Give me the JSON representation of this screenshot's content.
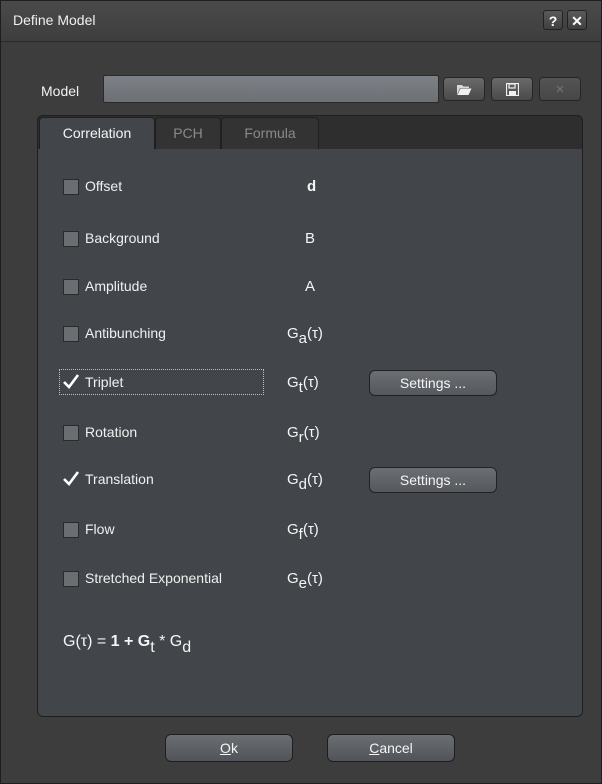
{
  "window": {
    "title": "Define Model",
    "help_label": "?",
    "close_label": "✕"
  },
  "model": {
    "label": "Model",
    "value": "",
    "open_icon": "folder-open-icon",
    "save_icon": "save-icon",
    "delete_icon": "delete-icon"
  },
  "tabs": [
    {
      "label": "Correlation",
      "active": true
    },
    {
      "label": "PCH",
      "active": false
    },
    {
      "label": "Formula",
      "active": false
    }
  ],
  "components": [
    {
      "label": "Offset",
      "symbol": "d",
      "sub": "",
      "suffix": "",
      "checked": false
    },
    {
      "label": "Background",
      "symbol": "B",
      "sub": "",
      "suffix": "",
      "checked": false
    },
    {
      "label": "Amplitude",
      "symbol": "A",
      "sub": "",
      "suffix": "",
      "checked": false
    },
    {
      "label": "Antibunching",
      "symbol": "G",
      "sub": "a",
      "suffix": "(τ)",
      "checked": false
    },
    {
      "label": "Triplet",
      "symbol": "G",
      "sub": "t",
      "suffix": "(τ)",
      "checked": true,
      "settings": "Settings ..."
    },
    {
      "label": "Rotation",
      "symbol": "G",
      "sub": "r",
      "suffix": "(τ)",
      "checked": false
    },
    {
      "label": "Translation",
      "symbol": "G",
      "sub": "d",
      "suffix": "(τ)",
      "checked": true,
      "settings": "Settings ..."
    },
    {
      "label": "Flow",
      "symbol": "G",
      "sub": "f",
      "suffix": "(τ)",
      "checked": false
    },
    {
      "label": "Stretched Exponential",
      "symbol": "G",
      "sub": "e",
      "suffix": "(τ)",
      "checked": false
    }
  ],
  "formula": {
    "lhs": "G(τ) = ",
    "one_plus": "1 + G",
    "sub_t": "t",
    "times": " * G",
    "sub_d": "d"
  },
  "footer": {
    "ok_mnemonic": "O",
    "ok_rest": "k",
    "cancel_mnemonic": "C",
    "cancel_rest": "ancel"
  }
}
